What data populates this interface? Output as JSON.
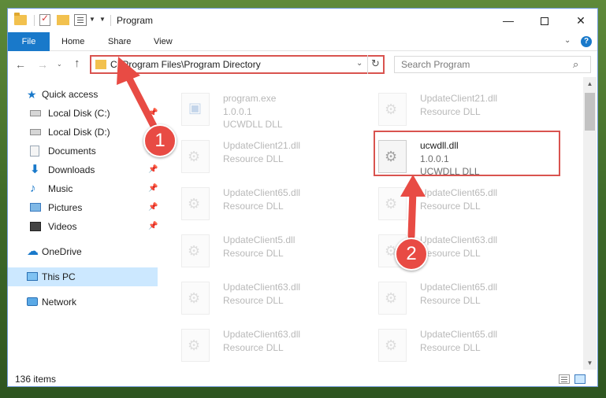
{
  "window": {
    "title": "Program",
    "controls": {
      "minimize": "—",
      "maximize": "",
      "close": "✕"
    }
  },
  "ribbon": {
    "tabs": [
      "File",
      "Home",
      "Share",
      "View"
    ],
    "collapse": "⌄",
    "help": "?"
  },
  "nav": {
    "back": "←",
    "forward": "→",
    "recent": "⌄",
    "up": "↑",
    "address": "C:\\Program Files\\Program Directory",
    "address_dropdown": "⌄",
    "refresh": "↻",
    "search_placeholder": "Search Program",
    "search_icon": "⌕"
  },
  "sidebar": {
    "quick_access": "Quick access",
    "items": [
      {
        "label": "Local Disk (C:)",
        "icon": "disk-icon",
        "pin": "📌"
      },
      {
        "label": "Local Disk (D:)",
        "icon": "disk-icon",
        "pin": ""
      },
      {
        "label": "Documents",
        "icon": "documents-icon",
        "pin": "📌"
      },
      {
        "label": "Downloads",
        "icon": "downloads-icon",
        "pin": "📌"
      },
      {
        "label": "Music",
        "icon": "music-icon",
        "pin": "📌"
      },
      {
        "label": "Pictures",
        "icon": "pictures-icon",
        "pin": "📌"
      },
      {
        "label": "Videos",
        "icon": "videos-icon",
        "pin": "📌"
      }
    ],
    "onedrive": "OneDrive",
    "this_pc": "This PC",
    "network": "Network"
  },
  "files": [
    {
      "name": "program.exe",
      "l2": "1.0.0.1",
      "l3": "UCWDLL DLL"
    },
    {
      "name": "UpdateClient21.dll",
      "l2": "Resource DLL",
      "l3": ""
    },
    {
      "name": "UpdateClient21.dll",
      "l2": "Resource DLL",
      "l3": ""
    },
    {
      "name": "ucwdll.dll",
      "l2": "1.0.0.1",
      "l3": "UCWDLL DLL"
    },
    {
      "name": "UpdateClient65.dll",
      "l2": "Resource DLL",
      "l3": ""
    },
    {
      "name": "UpdateClient65.dll",
      "l2": "Resource DLL",
      "l3": ""
    },
    {
      "name": "UpdateClient5.dll",
      "l2": "Resource DLL",
      "l3": ""
    },
    {
      "name": "UpdateClient63.dll",
      "l2": "Resource DLL",
      "l3": ""
    },
    {
      "name": "UpdateClient63.dll",
      "l2": "Resource DLL",
      "l3": ""
    },
    {
      "name": "UpdateClient65.dll",
      "l2": "Resource DLL",
      "l3": ""
    },
    {
      "name": "UpdateClient63.dll",
      "l2": "Resource DLL",
      "l3": ""
    },
    {
      "name": "UpdateClient65.dll",
      "l2": "Resource DLL",
      "l3": ""
    }
  ],
  "status": {
    "items_count": "136 items"
  },
  "annotations": {
    "step1": "1",
    "step2": "2",
    "color": "#e84b44"
  },
  "scroll": {
    "up": "▲",
    "down": "▼"
  }
}
